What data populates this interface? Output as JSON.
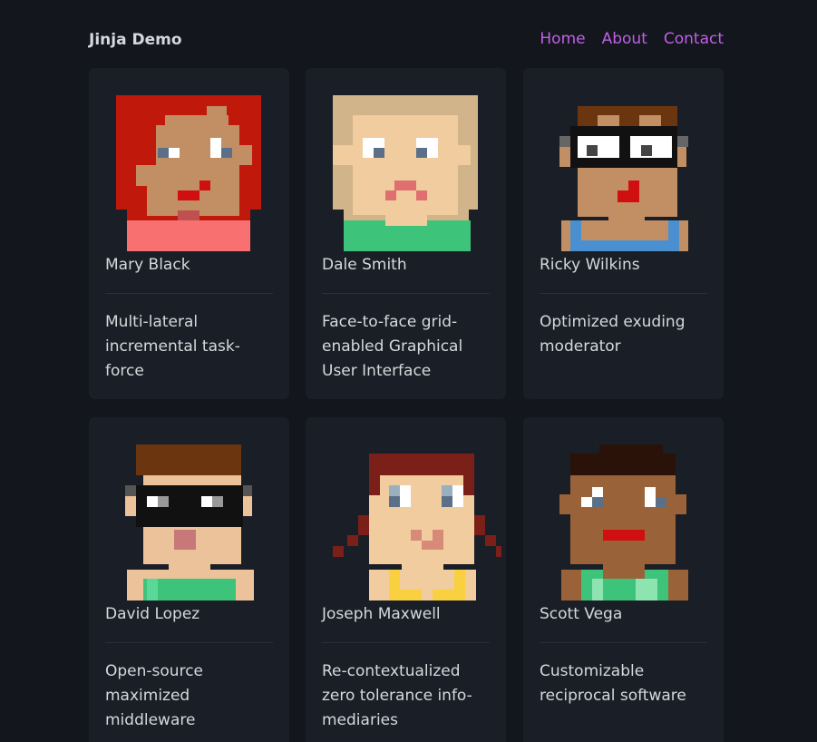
{
  "nav": {
    "brand": "Jinja Demo",
    "links": [
      "Home",
      "About",
      "Contact"
    ]
  },
  "colors": {
    "background": "#13161c",
    "card": "#1a1e26",
    "link": "#c060e8",
    "text": "#d6d8dc"
  },
  "cards": [
    {
      "name": "Mary Black",
      "description": "Multi-lateral incremental task-force",
      "avatar_icon": "pixel-avatar-red-hair"
    },
    {
      "name": "Dale Smith",
      "description": "Face-to-face grid-enabled Graphical User Interface",
      "avatar_icon": "pixel-avatar-blonde-hair"
    },
    {
      "name": "Ricky Wilkins",
      "description": "Optimized exuding moderator",
      "avatar_icon": "pixel-avatar-glasses"
    },
    {
      "name": "David Lopez",
      "description": "Open-source maximized middleware",
      "avatar_icon": "pixel-avatar-sunglasses"
    },
    {
      "name": "Joseph Maxwell",
      "description": "Re-contextualized zero tolerance info-mediaries",
      "avatar_icon": "pixel-avatar-pigtails"
    },
    {
      "name": "Scott Vega",
      "description": "Customizable reciprocal software",
      "avatar_icon": "pixel-avatar-dark-hair"
    }
  ]
}
